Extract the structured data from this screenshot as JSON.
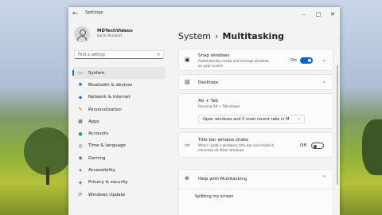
{
  "window": {
    "title": "Settings",
    "controls": [
      "–",
      "□",
      "✕"
    ]
  },
  "user": {
    "name": "MDTechVideos",
    "account_type": "Local Account"
  },
  "search": {
    "placeholder": "Find a setting"
  },
  "nav": [
    {
      "label": "System",
      "icon": "monitor-icon",
      "glyph": "▭",
      "color": "#0067c0",
      "active": true
    },
    {
      "label": "Bluetooth & devices",
      "icon": "bluetooth-icon",
      "glyph": "✱",
      "color": "#0067c0",
      "active": false
    },
    {
      "label": "Network & internet",
      "icon": "wifi-icon",
      "glyph": "◆",
      "color": "#3b6ea5",
      "active": false
    },
    {
      "label": "Personalization",
      "icon": "brush-icon",
      "glyph": "✎",
      "color": "#c0582e",
      "active": false
    },
    {
      "label": "Apps",
      "icon": "apps-icon",
      "glyph": "▦",
      "color": "#555555",
      "active": false
    },
    {
      "label": "Accounts",
      "icon": "person-icon",
      "glyph": "●",
      "color": "#2e9e5b",
      "active": false
    },
    {
      "label": "Time & language",
      "icon": "globe-clock-icon",
      "glyph": "◎",
      "color": "#0067c0",
      "active": false
    },
    {
      "label": "Gaming",
      "icon": "gamepad-icon",
      "glyph": "◉",
      "color": "#666666",
      "active": false
    },
    {
      "label": "Accessibility",
      "icon": "accessibility-icon",
      "glyph": "✦",
      "color": "#0067c0",
      "active": false
    },
    {
      "label": "Privacy & security",
      "icon": "shield-icon",
      "glyph": "◈",
      "color": "#666666",
      "active": false
    },
    {
      "label": "Windows Update",
      "icon": "update-icon",
      "glyph": "⟳",
      "color": "#0067c0",
      "active": false
    }
  ],
  "breadcrumb": {
    "parent": "System",
    "separator": "›",
    "current": "Multitasking"
  },
  "snap": {
    "title": "Snap windows",
    "description": "Automatically resize and arrange windows on your screen",
    "state_label": "On",
    "enabled": true
  },
  "desktops": {
    "title": "Desktops"
  },
  "alttab": {
    "title": "Alt + Tab",
    "description": "Pressing Alt + Tab shows",
    "selected": "Open windows and 5 most recent tabs in M"
  },
  "shake": {
    "title": "Title bar window shake",
    "description": "When I grab a window's title bar and shake it, minimize all other windows",
    "state_label": "Off",
    "enabled": false
  },
  "help": {
    "title": "Help with Multitasking",
    "link": "Splitting my screen"
  }
}
